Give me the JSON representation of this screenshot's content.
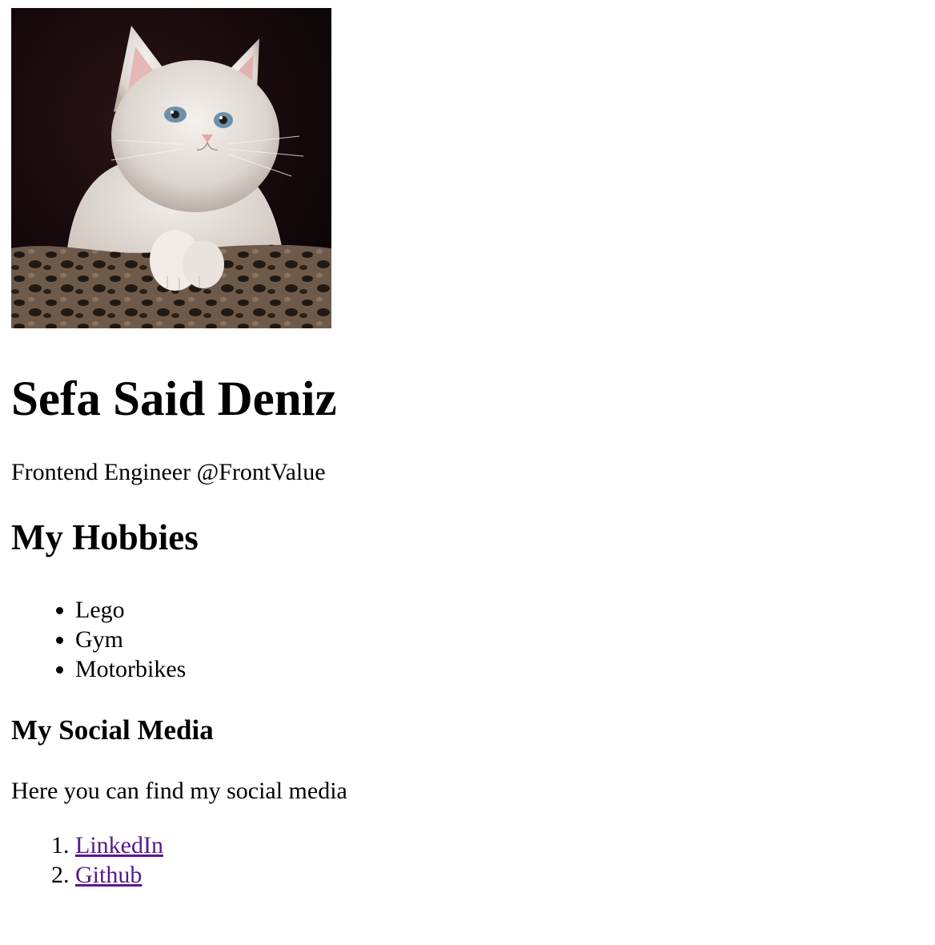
{
  "profile": {
    "image_alt": "Kitten",
    "name": "Sefa Said Deniz",
    "subtitle": "Frontend Engineer @FrontValue"
  },
  "hobbies": {
    "heading": "My Hobbies",
    "items": [
      "Lego",
      "Gym",
      "Motorbikes"
    ]
  },
  "social": {
    "heading": "My Social Media",
    "intro": "Here you can find my social media",
    "links": [
      {
        "label": "LinkedIn"
      },
      {
        "label": "Github"
      }
    ]
  },
  "colors": {
    "link_visited": "#551a8b",
    "text": "#000000",
    "background": "#ffffff"
  }
}
